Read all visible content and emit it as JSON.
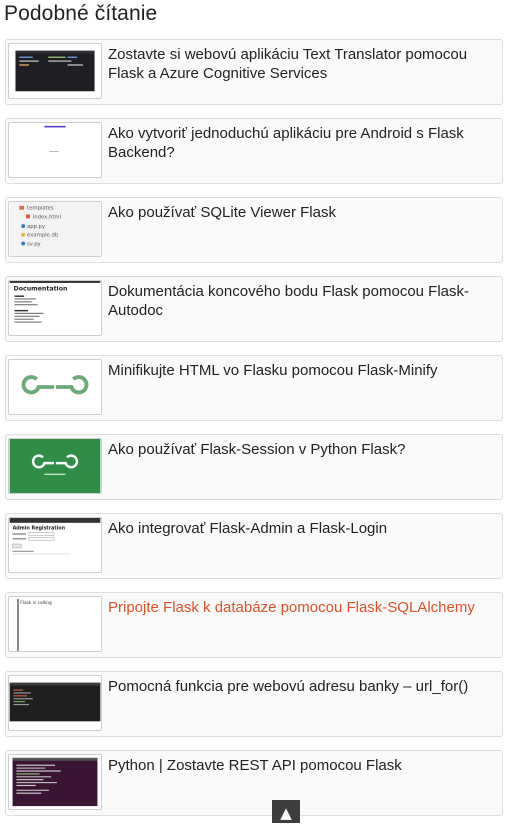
{
  "section": {
    "title": "Podobné čítanie"
  },
  "articles": [
    {
      "title": "Zostavte si webovú aplikáciu Text Translator pomocou Flask a Azure Cognitive Services",
      "thumbnail_icon": "code-editor-screenshot"
    },
    {
      "title": "Ako vytvoriť jednoduchú aplikáciu pre Android s Flask Backend?",
      "thumbnail_icon": "blank-app-screenshot"
    },
    {
      "title": "Ako používať SQLite Viewer Flask",
      "thumbnail_icon": "file-tree-screenshot",
      "thumbnail_text": [
        "templates",
        "index.html",
        "app.py",
        "example.db",
        "sv.py"
      ]
    },
    {
      "title": "Dokumentácia koncového bodu Flask pomocou Flask-Autodoc",
      "thumbnail_icon": "documentation-page-screenshot",
      "thumbnail_text": [
        "Documentation"
      ]
    },
    {
      "title": "Minifikujte HTML vo Flasku pomocou Flask-Minify",
      "thumbnail_icon": "gfg-logo"
    },
    {
      "title": "Ako používať Flask-Session v Python Flask?",
      "thumbnail_icon": "gfg-logo-banner"
    },
    {
      "title": "Ako integrovať Flask-Admin a Flask-Login",
      "thumbnail_icon": "login-form-screenshot",
      "thumbnail_text": [
        "Admin Registration"
      ]
    },
    {
      "title": "Pripojte Flask k databáze pomocou Flask-SQLAlchemy",
      "thumbnail_icon": "text-page-screenshot",
      "thumbnail_text": [
        "Flask is calling"
      ],
      "active": true
    },
    {
      "title": "Pomocná funkcia pre webovú adresu banky – url_for()",
      "thumbnail_icon": "terminal-screenshot"
    },
    {
      "title": "Python | Zostavte REST API pomocou Flask",
      "thumbnail_icon": "terminal-screenshot"
    }
  ],
  "scroll_top": {
    "label": "▲"
  },
  "colors": {
    "text": "#222222",
    "active_link": "#d9532c",
    "card_background": "#fafafa",
    "card_border": "#dddddd",
    "gfg_green": "#2f8d46",
    "scroll_button": "#3d3d3d"
  }
}
